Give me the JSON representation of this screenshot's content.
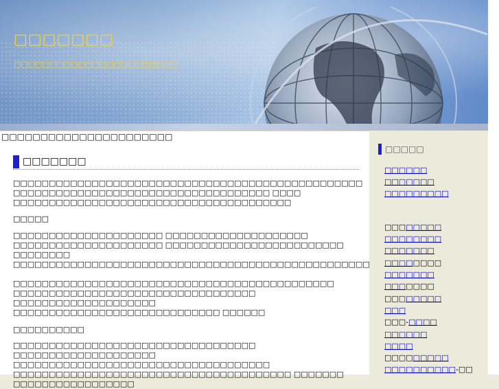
{
  "header": {
    "site_title": "□□□□□□□",
    "tagline": "□□□□□□□□□□□□□□□□□□□□□□□"
  },
  "breadcrumb": "□□□□□□□□□□□□□□□□□□□□□□",
  "post": {
    "title": "□□□□□□□",
    "p1": "□□□□□□□□□□□□□□□□□□□□□□□□□□□□□□□□□□□□□□□□□□□□□□□□□ □□□□□□□□□□□□□□□□□□□□□□□□□□□□□□□□□□□□ □□□□ □□□□□□□□□□□□□□□□□□□□□□□□□□□□□□□□□□□□□□□",
    "sub1": "□□□□□",
    "p2": "□□□□□□□□□□□□□□□□□□□□□ □□□□□□□□□□□□□□□□□□□□ □□□□□□□□□□□□□□□□□□□□□ □□□□□□□□□□□□□□□□□□□□□□□□□ □□□□□□□□",
    "p3": "□□□□□□□□□□□□□□□□□□□□□□□□□□□□□□□□□□□□□□□□□□□□□□□□□□□□□□□□□□□□□□□□□",
    "p4a": "□□□□□□□□□□□□□□□□□□□□□□□□□□□□□□□□□□□□□□□□□□□□□",
    "p4b": "□□□□□□□□□□□□□□□□□□□□□□□□□□□□□□□□□□ □□□□□□□□□□□□□□□□□□□□ □□□□□□□□□□□□□□□□□□□□□□□□□□□□□ □□□□□□",
    "sub2": "□□□□□□□□□□",
    "p5a": "□□□□□□□□□□□□□□□□□□□□□□□□□□□□□□□□□□ □□□□□□□□□□□□□□□□□□□□",
    "p5b": "□□□□□□□□□□□□□□□□□□□□□□□□□□□□□□□□□□□□ □□□□□□□□□□□□□□□□□□□□□□□□□□□□□□□□□□□□□□□ □□□□□□□ □□□□□□□□□□□□□□□□□"
  },
  "sidebar": {
    "heading": "□□□□□",
    "links_group1": [
      "□□□□□□",
      "□□□□□□□",
      "□□□□□□□□□"
    ],
    "links_group2": [
      {
        "plain": "□□□",
        "link": "□□□□□",
        "after": ""
      },
      {
        "plain": "",
        "link": "□□□□□□□□",
        "after": ""
      },
      {
        "plain": "",
        "link": "□□□□□□□",
        "after": ""
      },
      {
        "plain": "",
        "link": "□□□□",
        "after": "□□□□"
      },
      {
        "plain": "",
        "link": "□□□□□□□",
        "after": ""
      },
      {
        "plain": "",
        "link": "□□□",
        "after": "□□□□"
      },
      {
        "plain": "□□□",
        "link": "□□□□□",
        "after": ""
      },
      {
        "plain": "",
        "link": "□□□",
        "after": ""
      },
      {
        "plain": "□□□-",
        "link": "□□□□",
        "after": ""
      },
      {
        "plain": "",
        "link": "□□□□□□",
        "after": ""
      },
      {
        "plain": "",
        "link": "□□□□",
        "after": ""
      },
      {
        "plain": "□□□□",
        "link": "□□□□□",
        "after": ""
      },
      {
        "plain": "",
        "link": "□□□□□□□□□□",
        "after": "-□□"
      }
    ]
  },
  "colors": {
    "title_yellow": "#f4d440",
    "accent_blue": "#2020c8",
    "link_blue": "#0000cc",
    "sidebar_bg": "#ecebdb"
  }
}
